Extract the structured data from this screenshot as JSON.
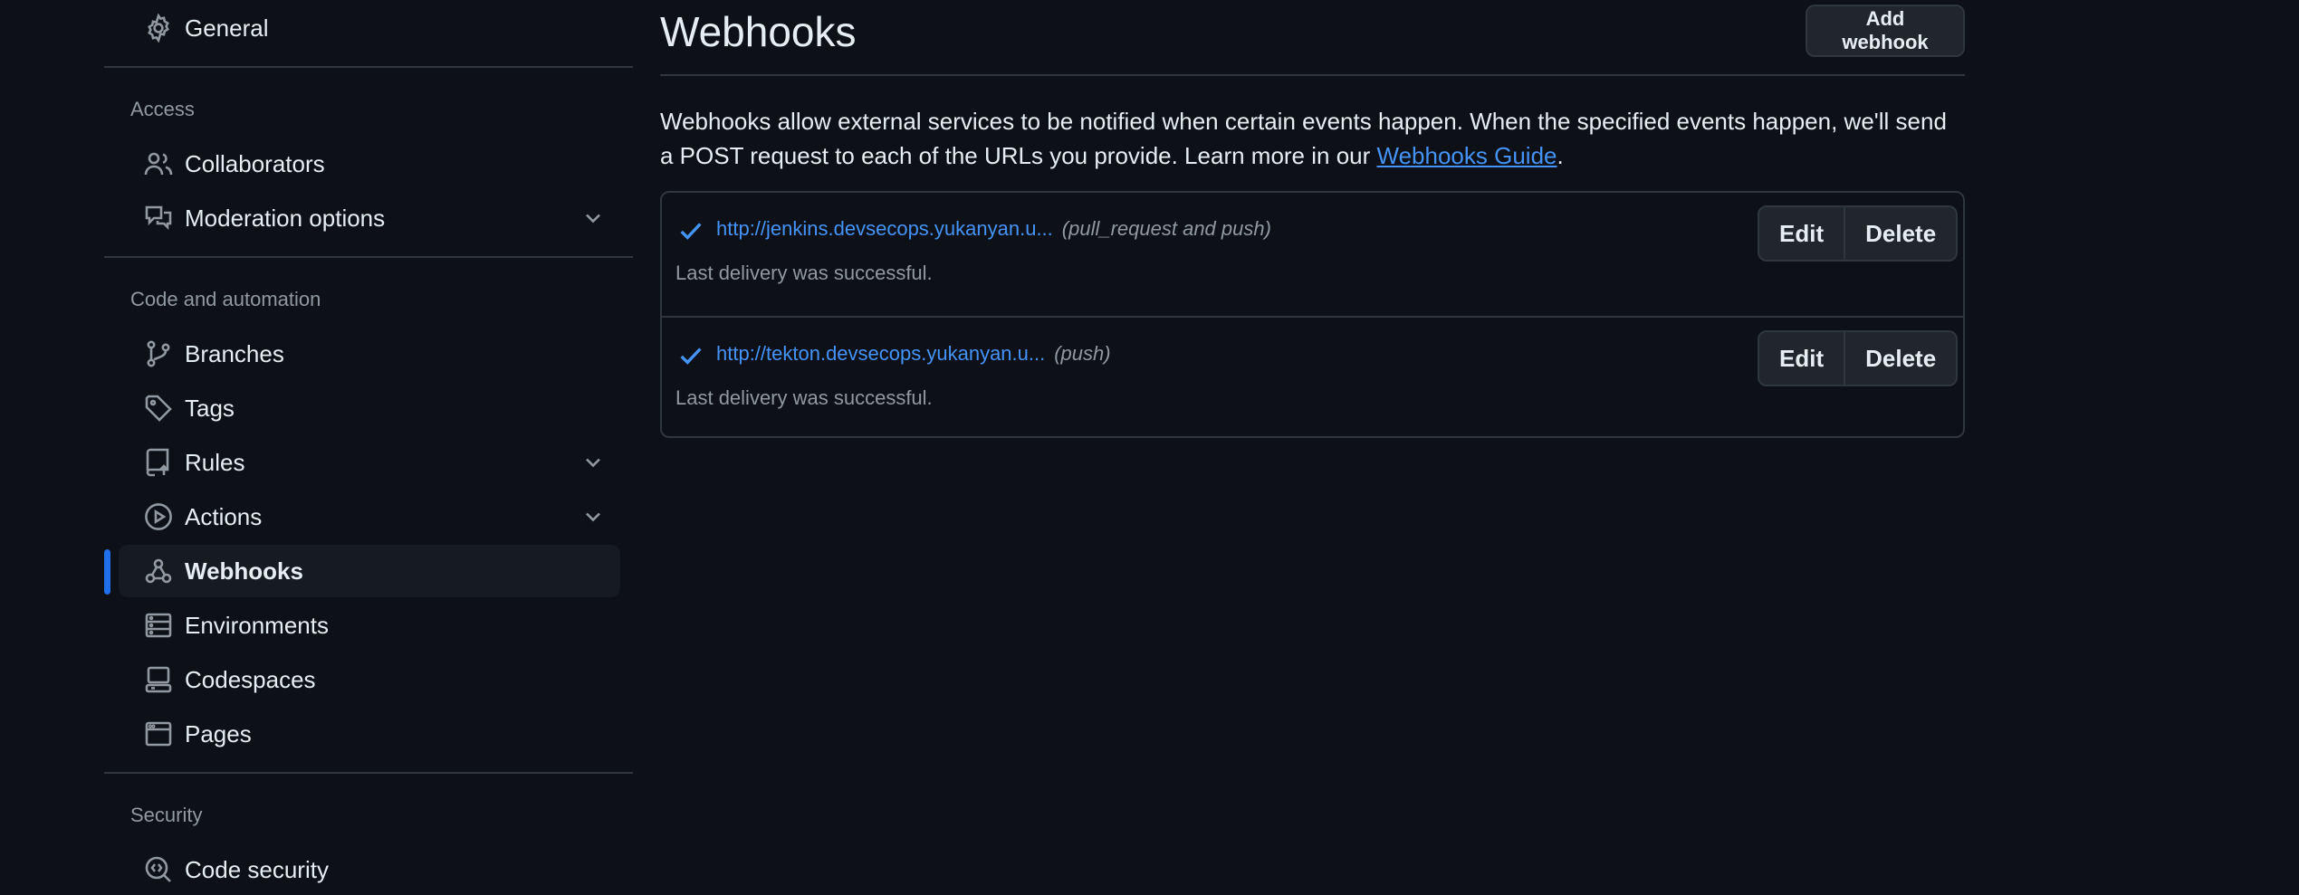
{
  "sidebar": {
    "general": {
      "label": "General",
      "icon": "gear-icon"
    },
    "sections": {
      "access": "Access",
      "code_automation": "Code and automation",
      "security": "Security"
    },
    "items": {
      "collaborators": {
        "label": "Collaborators",
        "icon": "people-icon"
      },
      "moderation": {
        "label": "Moderation options",
        "icon": "comment-discussion-icon"
      },
      "branches": {
        "label": "Branches",
        "icon": "git-branch-icon"
      },
      "tags": {
        "label": "Tags",
        "icon": "tag-icon"
      },
      "rules": {
        "label": "Rules",
        "icon": "repo-push-icon"
      },
      "actions": {
        "label": "Actions",
        "icon": "play-icon"
      },
      "webhooks": {
        "label": "Webhooks",
        "icon": "webhook-icon",
        "active": true
      },
      "environments": {
        "label": "Environments",
        "icon": "server-icon"
      },
      "codespaces": {
        "label": "Codespaces",
        "icon": "codespaces-icon"
      },
      "pages": {
        "label": "Pages",
        "icon": "browser-icon"
      },
      "code_security": {
        "label": "Code security",
        "icon": "codescan-icon"
      }
    }
  },
  "main": {
    "title": "Webhooks",
    "add_button": "Add webhook",
    "intro": {
      "text": "Webhooks allow external services to be notified when certain events happen. When the specified events happen, we'll send a POST request to each of the URLs you provide. Learn more in our ",
      "link": "Webhooks Guide",
      "end": "."
    },
    "hooks": [
      {
        "url": "http://jenkins.devsecops.yukanyan.u...",
        "events": "(pull_request and push)",
        "status": "Last delivery was successful.",
        "edit": "Edit",
        "delete": "Delete"
      },
      {
        "url": "http://tekton.devsecops.yukanyan.u...",
        "events": "(push)",
        "status": "Last delivery was successful.",
        "edit": "Edit",
        "delete": "Delete"
      }
    ]
  },
  "colors": {
    "background": "#0d1117",
    "border": "#30363d",
    "link": "#4493f8",
    "accent": "#1f6feb",
    "muted": "#9198a1"
  }
}
